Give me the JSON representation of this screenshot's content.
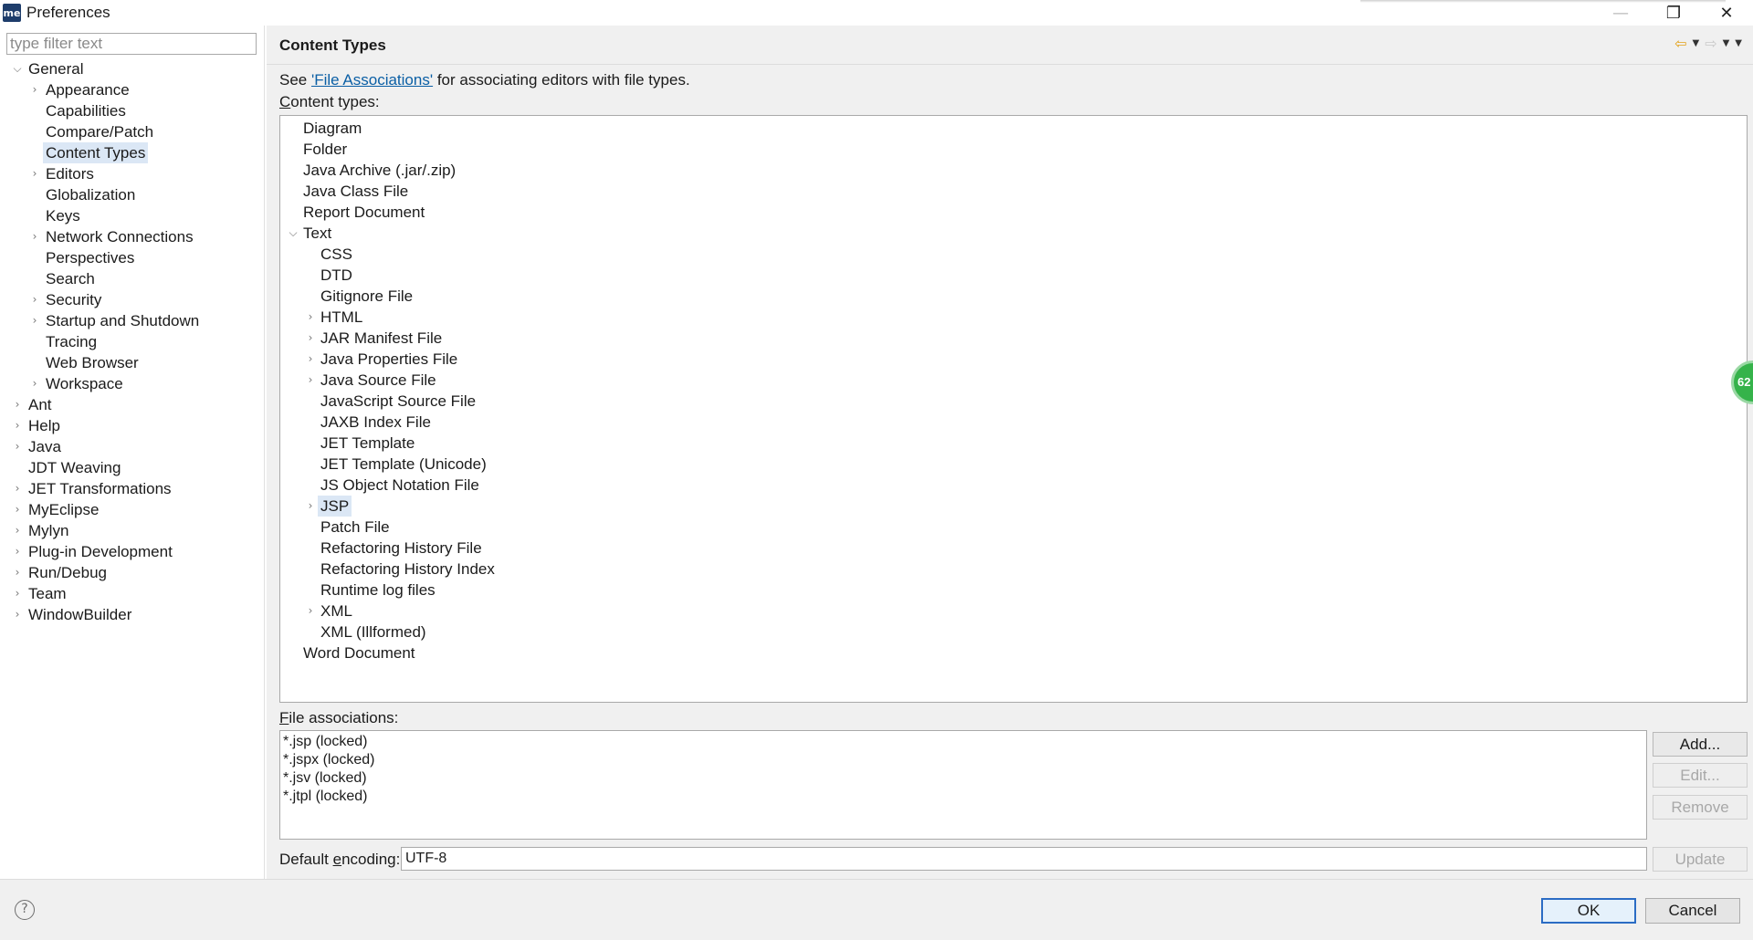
{
  "window": {
    "title": "Preferences",
    "app_icon_text": "me",
    "minimize_glyph": "—",
    "restore_glyph": "❐",
    "close_glyph": "✕"
  },
  "sidebar": {
    "filter_placeholder": "type filter text",
    "items": [
      {
        "label": "General",
        "level": 0,
        "twisty": "open"
      },
      {
        "label": "Appearance",
        "level": 1,
        "twisty": "closed"
      },
      {
        "label": "Capabilities",
        "level": 1,
        "twisty": "none"
      },
      {
        "label": "Compare/Patch",
        "level": 1,
        "twisty": "none"
      },
      {
        "label": "Content Types",
        "level": 1,
        "twisty": "none",
        "selected": true
      },
      {
        "label": "Editors",
        "level": 1,
        "twisty": "closed"
      },
      {
        "label": "Globalization",
        "level": 1,
        "twisty": "none"
      },
      {
        "label": "Keys",
        "level": 1,
        "twisty": "none"
      },
      {
        "label": "Network Connections",
        "level": 1,
        "twisty": "closed"
      },
      {
        "label": "Perspectives",
        "level": 1,
        "twisty": "none"
      },
      {
        "label": "Search",
        "level": 1,
        "twisty": "none"
      },
      {
        "label": "Security",
        "level": 1,
        "twisty": "closed"
      },
      {
        "label": "Startup and Shutdown",
        "level": 1,
        "twisty": "closed"
      },
      {
        "label": "Tracing",
        "level": 1,
        "twisty": "none"
      },
      {
        "label": "Web Browser",
        "level": 1,
        "twisty": "none"
      },
      {
        "label": "Workspace",
        "level": 1,
        "twisty": "closed"
      },
      {
        "label": "Ant",
        "level": 0,
        "twisty": "closed"
      },
      {
        "label": "Help",
        "level": 0,
        "twisty": "closed"
      },
      {
        "label": "Java",
        "level": 0,
        "twisty": "closed"
      },
      {
        "label": "JDT Weaving",
        "level": 0,
        "twisty": "none"
      },
      {
        "label": "JET Transformations",
        "level": 0,
        "twisty": "closed"
      },
      {
        "label": "MyEclipse",
        "level": 0,
        "twisty": "closed"
      },
      {
        "label": "Mylyn",
        "level": 0,
        "twisty": "closed"
      },
      {
        "label": "Plug-in Development",
        "level": 0,
        "twisty": "closed"
      },
      {
        "label": "Run/Debug",
        "level": 0,
        "twisty": "closed"
      },
      {
        "label": "Team",
        "level": 0,
        "twisty": "closed"
      },
      {
        "label": "WindowBuilder",
        "level": 0,
        "twisty": "closed"
      }
    ]
  },
  "page": {
    "title": "Content Types",
    "desc_prefix": "See ",
    "desc_link": "'File Associations'",
    "desc_suffix": " for associating editors with file types.",
    "content_types_label_first": "C",
    "content_types_label_rest": "ontent types:",
    "content_types": [
      {
        "label": "Diagram",
        "level": 0,
        "twisty": "none"
      },
      {
        "label": "Folder",
        "level": 0,
        "twisty": "none"
      },
      {
        "label": "Java Archive (.jar/.zip)",
        "level": 0,
        "twisty": "none"
      },
      {
        "label": "Java Class File",
        "level": 0,
        "twisty": "none"
      },
      {
        "label": "Report Document",
        "level": 0,
        "twisty": "none"
      },
      {
        "label": "Text",
        "level": 0,
        "twisty": "open"
      },
      {
        "label": "CSS",
        "level": 1,
        "twisty": "none"
      },
      {
        "label": "DTD",
        "level": 1,
        "twisty": "none"
      },
      {
        "label": "Gitignore File",
        "level": 1,
        "twisty": "none"
      },
      {
        "label": "HTML",
        "level": 1,
        "twisty": "closed"
      },
      {
        "label": "JAR Manifest File",
        "level": 1,
        "twisty": "closed"
      },
      {
        "label": "Java Properties File",
        "level": 1,
        "twisty": "closed"
      },
      {
        "label": "Java Source File",
        "level": 1,
        "twisty": "closed"
      },
      {
        "label": "JavaScript Source File",
        "level": 1,
        "twisty": "none"
      },
      {
        "label": "JAXB Index File",
        "level": 1,
        "twisty": "none"
      },
      {
        "label": "JET Template",
        "level": 1,
        "twisty": "none"
      },
      {
        "label": "JET Template (Unicode)",
        "level": 1,
        "twisty": "none"
      },
      {
        "label": "JS Object Notation File",
        "level": 1,
        "twisty": "none"
      },
      {
        "label": "JSP",
        "level": 1,
        "twisty": "closed",
        "selected": true
      },
      {
        "label": "Patch File",
        "level": 1,
        "twisty": "none"
      },
      {
        "label": "Refactoring History File",
        "level": 1,
        "twisty": "none"
      },
      {
        "label": "Refactoring History Index",
        "level": 1,
        "twisty": "none"
      },
      {
        "label": "Runtime log files",
        "level": 1,
        "twisty": "none"
      },
      {
        "label": "XML",
        "level": 1,
        "twisty": "closed"
      },
      {
        "label": "XML (Illformed)",
        "level": 1,
        "twisty": "none"
      },
      {
        "label": "Word Document",
        "level": 0,
        "twisty": "none"
      }
    ],
    "file_assoc_label_first": "F",
    "file_assoc_label_rest": "ile associations:",
    "file_associations": [
      "*.jsp (locked)",
      "*.jspx (locked)",
      "*.jsv (locked)",
      "*.jtpl (locked)"
    ],
    "buttons": {
      "add": "Add...",
      "edit": "Edit...",
      "remove": "Remove",
      "update": "Update"
    },
    "encoding_label_prefix": "Default ",
    "encoding_label_ul": "e",
    "encoding_label_suffix": "ncoding:",
    "encoding_value": "UTF-8"
  },
  "dialog": {
    "ok": "OK",
    "cancel": "Cancel",
    "help_glyph": "?"
  },
  "badge": {
    "text": "62"
  },
  "colors": {
    "selection": "#dbe7f5",
    "link": "#0b5fa5",
    "nav_arrow": "#e3a21a",
    "default_button_border": "#2b6cc4",
    "badge": "#35b34a"
  }
}
